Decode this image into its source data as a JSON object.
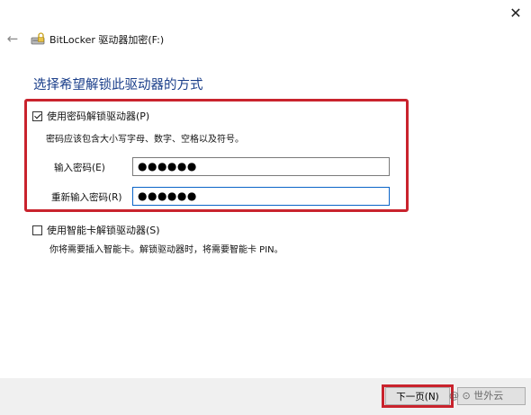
{
  "window": {
    "close_glyph": "✕",
    "back_glyph": "←",
    "title": "BitLocker 驱动器加密(F:)"
  },
  "main": {
    "heading": "选择希望解锁此驱动器的方式",
    "password_option": {
      "label": "使用密码解锁驱动器(P)",
      "checked": true,
      "hint": "密码应该包含大小写字母、数字、空格以及符号。",
      "enter_label": "输入密码(E)",
      "enter_value": "●●●●●●",
      "reenter_label": "重新输入密码(R)",
      "reenter_value": "●●●●●●"
    },
    "smartcard_option": {
      "label": "使用智能卡解锁驱动器(S)",
      "checked": false,
      "hint": "你将需要插入智能卡。解锁驱动器时，将需要智能卡 PIN。"
    }
  },
  "footer": {
    "next_label": "下一页(N)",
    "watermark": "@ ⊙ 世外云"
  },
  "colors": {
    "heading": "#1a3e8a",
    "highlight": "#c9232d"
  }
}
